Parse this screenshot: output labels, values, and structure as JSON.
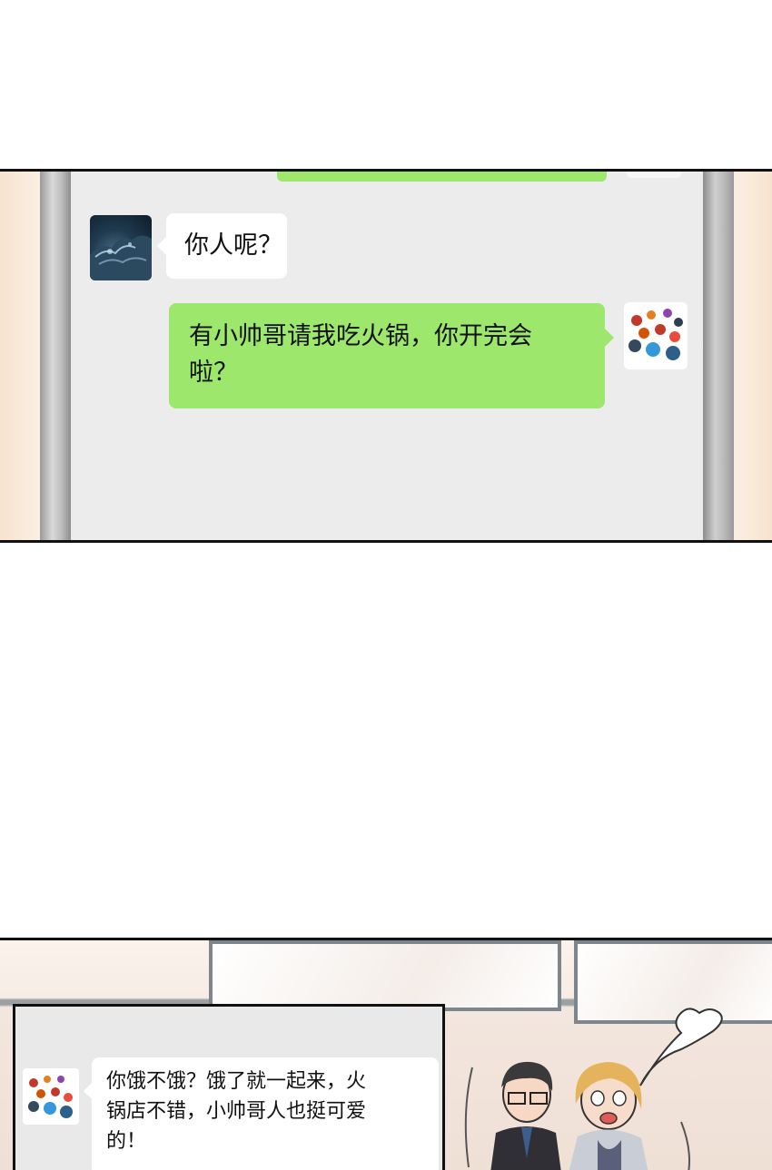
{
  "panel_chat": {
    "messages": [
      {
        "side": "left",
        "avatar": "ocean-wave-avatar",
        "text": "你人呢？"
      },
      {
        "side": "right",
        "avatar": "marbles-avatar",
        "lines": [
          "有小帅哥请我吃火锅，你开完会",
          "啦？"
        ]
      }
    ]
  },
  "panel_office": {
    "message": {
      "avatar": "marbles-avatar",
      "lines": [
        "你饿不饿？饿了就一起来，火",
        "锅店不错，小帅哥人也挺可爱",
        "的！"
      ]
    }
  },
  "colors": {
    "bubble_green": "#9de76d",
    "bubble_white": "#ffffff",
    "screen_bg": "#ececec",
    "border": "#111111"
  }
}
